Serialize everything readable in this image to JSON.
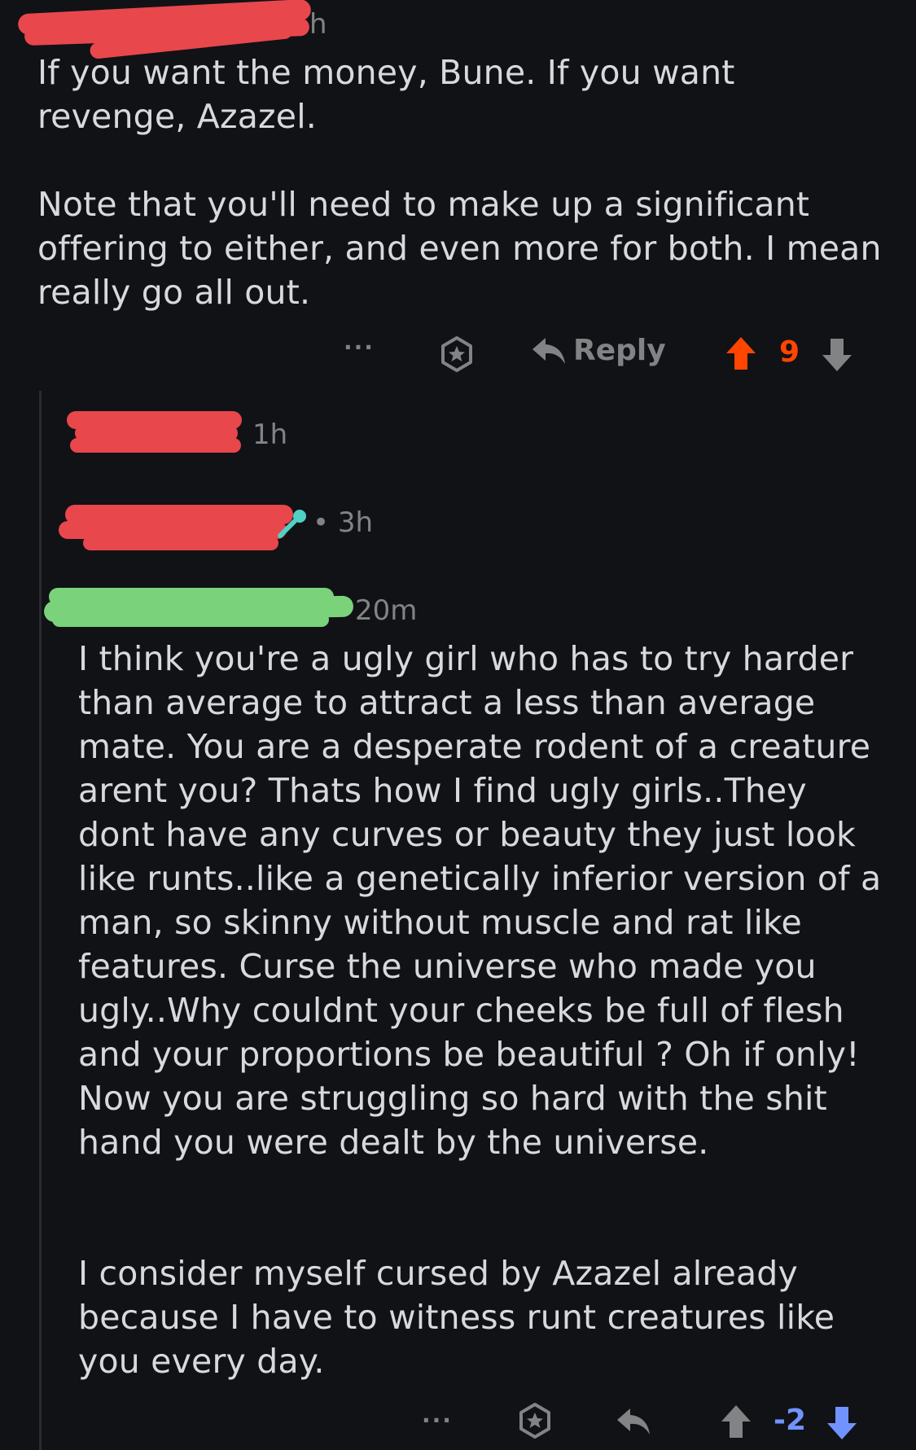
{
  "top_comment": {
    "time": "3h",
    "time_visible_fragment": "h",
    "paragraphs": [
      "If you want the money, Bune. If you want\nrevenge, Azazel.",
      "Note that you'll need to make up a significant\noffering to either, and even more for both. I mean\nreally go all out."
    ],
    "actions": {
      "more_label": "···",
      "reply_label": "Reply",
      "score": "9",
      "upvoted": true
    }
  },
  "replies": [
    {
      "time": "1h"
    },
    {
      "time": "• 3h"
    },
    {
      "time": "20m",
      "paragraphs": [
        "I think you're a ugly girl who has to try harder\nthan average to attract a less than average\nmate. You are a desperate rodent of a creature\narent you? Thats how I find ugly girls..They\ndont have any curves or beauty they just look\nlike runts..like a genetically inferior version of a\nman, so skinny without muscle and rat like\nfeatures. Curse the universe who made you\nugly..Why couldnt your cheeks be full of flesh\nand your proportions be beautiful ? Oh if only!\nNow you are struggling so hard with the shit\nhand you were dealt by the universe.",
        "I consider myself cursed by Azazel already\nbecause I have to witness runt creatures like\nyou every day."
      ],
      "actions": {
        "more_label": "···",
        "score": "-2",
        "downvoted": true
      }
    }
  ],
  "colors": {
    "background": "#111216",
    "text": "#d7dadc",
    "meta": "#818384",
    "upvote": "#ff4500",
    "downvote": "#7193ff",
    "redact_red": "#e8474c",
    "redact_green": "#7ad37a",
    "badge_teal": "#4fd1c5"
  }
}
